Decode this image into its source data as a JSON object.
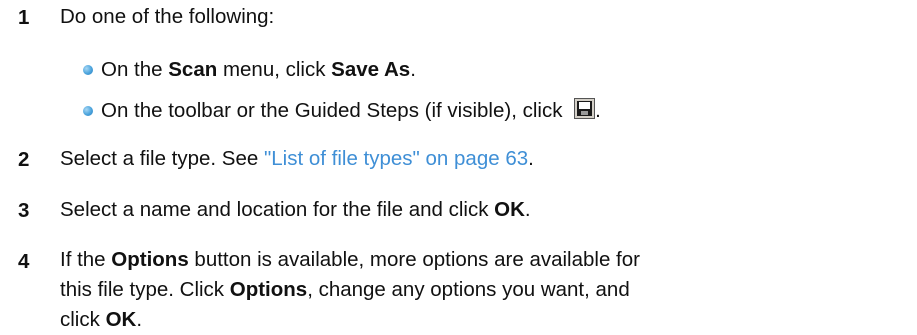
{
  "steps": [
    {
      "number": "1",
      "text": "Do one of the following:",
      "bullets": [
        {
          "parts": [
            "On the ",
            "Scan",
            " menu, click ",
            "Save As",
            "."
          ]
        },
        {
          "parts": [
            "On the toolbar or the Guided Steps (if visible), click ",
            "."
          ],
          "icon": "save-disk-icon"
        }
      ]
    },
    {
      "number": "2",
      "parts": [
        "Select a file type. See ",
        "\"List of file types\" on page 63",
        "."
      ]
    },
    {
      "number": "3",
      "parts": [
        "Select a name and location for the file and click ",
        "OK",
        "."
      ]
    },
    {
      "number": "4",
      "parts": [
        "If the ",
        "Options",
        " button is available, more options are available for",
        "this file type. Click ",
        "Options",
        ", change any options you want, and",
        "click ",
        "OK",
        "."
      ]
    }
  ],
  "colors": {
    "text": "#111111",
    "link": "#3f8fd6",
    "bullet": "#4aa3dc"
  }
}
